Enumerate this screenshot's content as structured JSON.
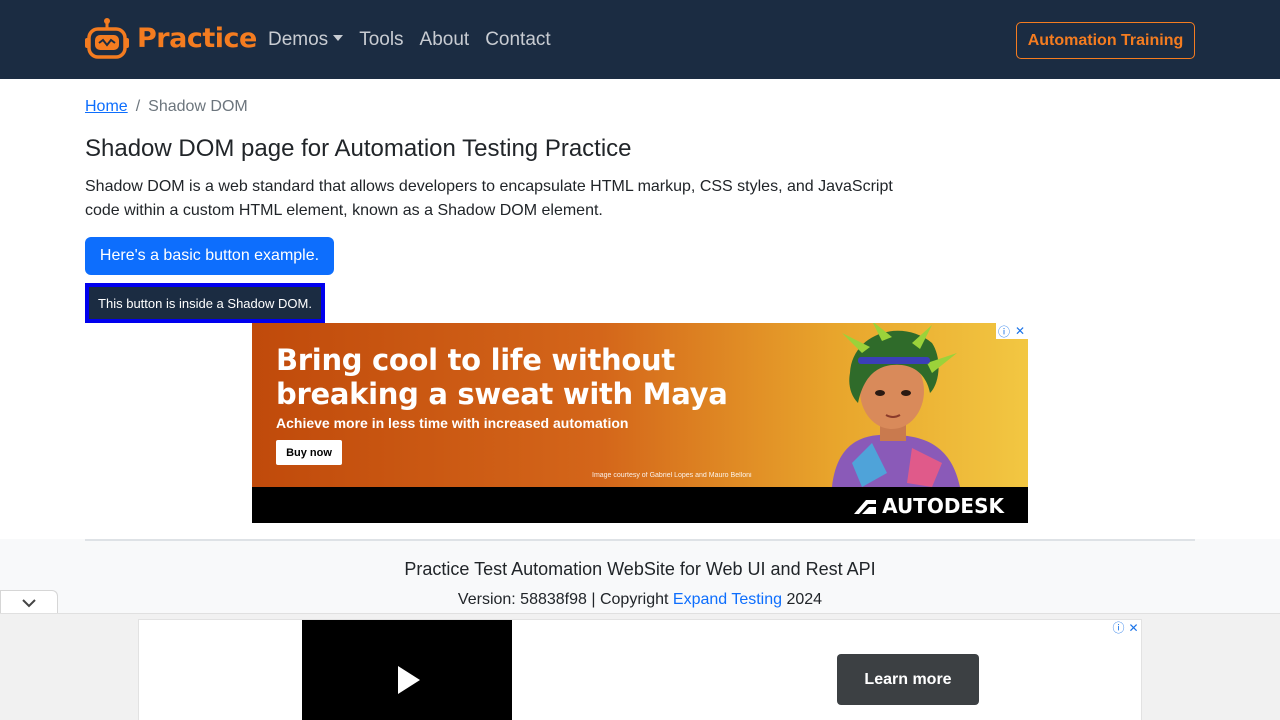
{
  "nav": {
    "brand": "Practice",
    "links": [
      {
        "label": "Demos",
        "dropdown": true
      },
      {
        "label": "Tools"
      },
      {
        "label": "About"
      },
      {
        "label": "Contact"
      }
    ],
    "cta": "Automation Training"
  },
  "breadcrumb": {
    "home": "Home",
    "separator": "/",
    "current": "Shadow DOM"
  },
  "main": {
    "title": "Shadow DOM page for Automation Testing Practice",
    "intro": "Shadow DOM is a web standard that allows developers to encapsulate HTML markup, CSS styles, and JavaScript code within a custom HTML element, known as a Shadow DOM element.",
    "basic_button": "Here's a basic button example.",
    "shadow_button": "This button is inside a Shadow DOM."
  },
  "ad_banner": {
    "headline_line1": "Bring cool to life without",
    "headline_line2": "breaking a sweat with Maya",
    "subline": "Achieve more in less time with increased automation",
    "cta": "Buy now",
    "credit": "Image courtesy of Gabriel Lopes and Mauro Belloni",
    "brand": "AUTODESK",
    "info_glyph": "ⓘ",
    "close_glyph": "✕"
  },
  "footer": {
    "title": "Practice Test Automation WebSite for Web UI and Rest API",
    "version_prefix": "Version: 58838f98 | Copyright ",
    "link": "Expand Testing",
    "year": " 2024"
  },
  "anchor_ad": {
    "cta": "Learn more",
    "info_glyph": "ⓘ",
    "close_glyph": "✕"
  },
  "colors": {
    "nav_bg": "#1b2c42",
    "brand_orange": "#f47c20",
    "primary_blue": "#0d6efd"
  }
}
